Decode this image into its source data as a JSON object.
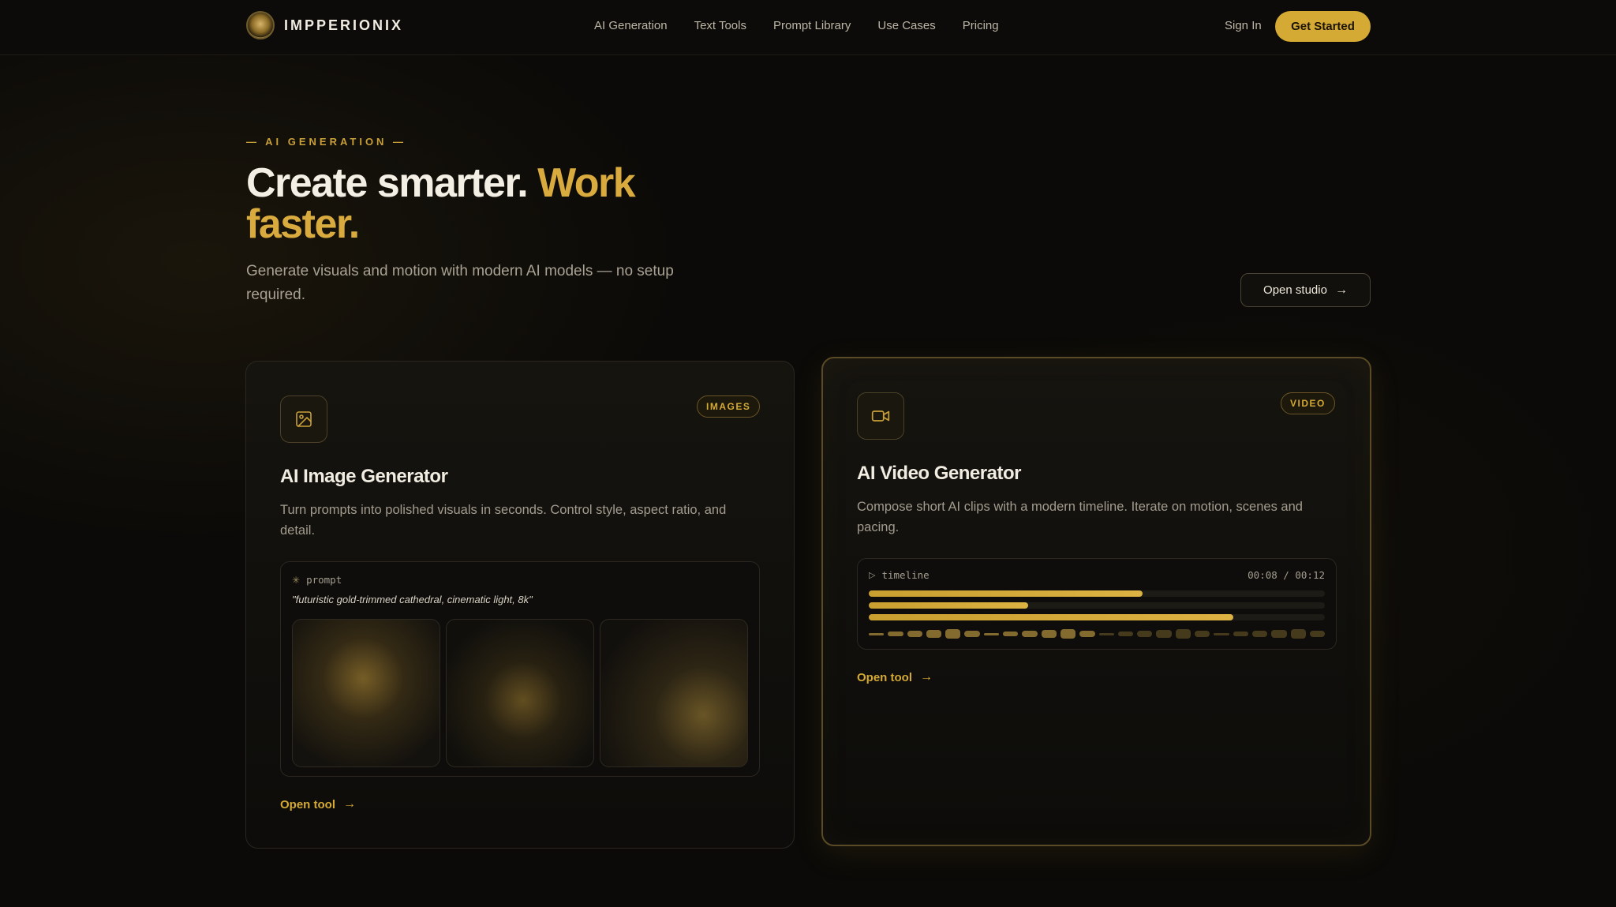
{
  "nav": {
    "brand": "IMPPERIONIX",
    "links": [
      "AI Generation",
      "Text Tools",
      "Prompt Library",
      "Use Cases",
      "Pricing"
    ],
    "sign_in": "Sign In",
    "cta": "Get Started"
  },
  "hero": {
    "eyebrow": "— AI GENERATION —",
    "headline_white": "Create smarter.",
    "headline_gold": "Work faster.",
    "subtitle": "Generate visuals and motion with modern AI models — no setup required.",
    "open_studio": "Open studio"
  },
  "cards": {
    "image": {
      "badge": "IMAGES",
      "title": "AI Image Generator",
      "description": "Turn prompts into polished visuals in seconds. Control style, aspect ratio, and detail.",
      "prompt_label": "prompt",
      "prompt_text": "\"futuristic gold-trimmed cathedral, cinematic light, 8k\"",
      "open_tool": "Open tool",
      "icon": "image-icon"
    },
    "video": {
      "badge": "VIDEO",
      "title": "AI Video Generator",
      "description": "Compose short AI clips with a modern timeline. Iterate on motion, scenes and pacing.",
      "timeline_label": "timeline",
      "timeline_time": "00:08 / 00:12",
      "tracks_progress": [
        0.6,
        0.35,
        0.8
      ],
      "open_tool": "Open tool",
      "icon": "video-camera-icon"
    }
  },
  "colors": {
    "accent": "#d4a934",
    "background": "#0b0a08"
  }
}
